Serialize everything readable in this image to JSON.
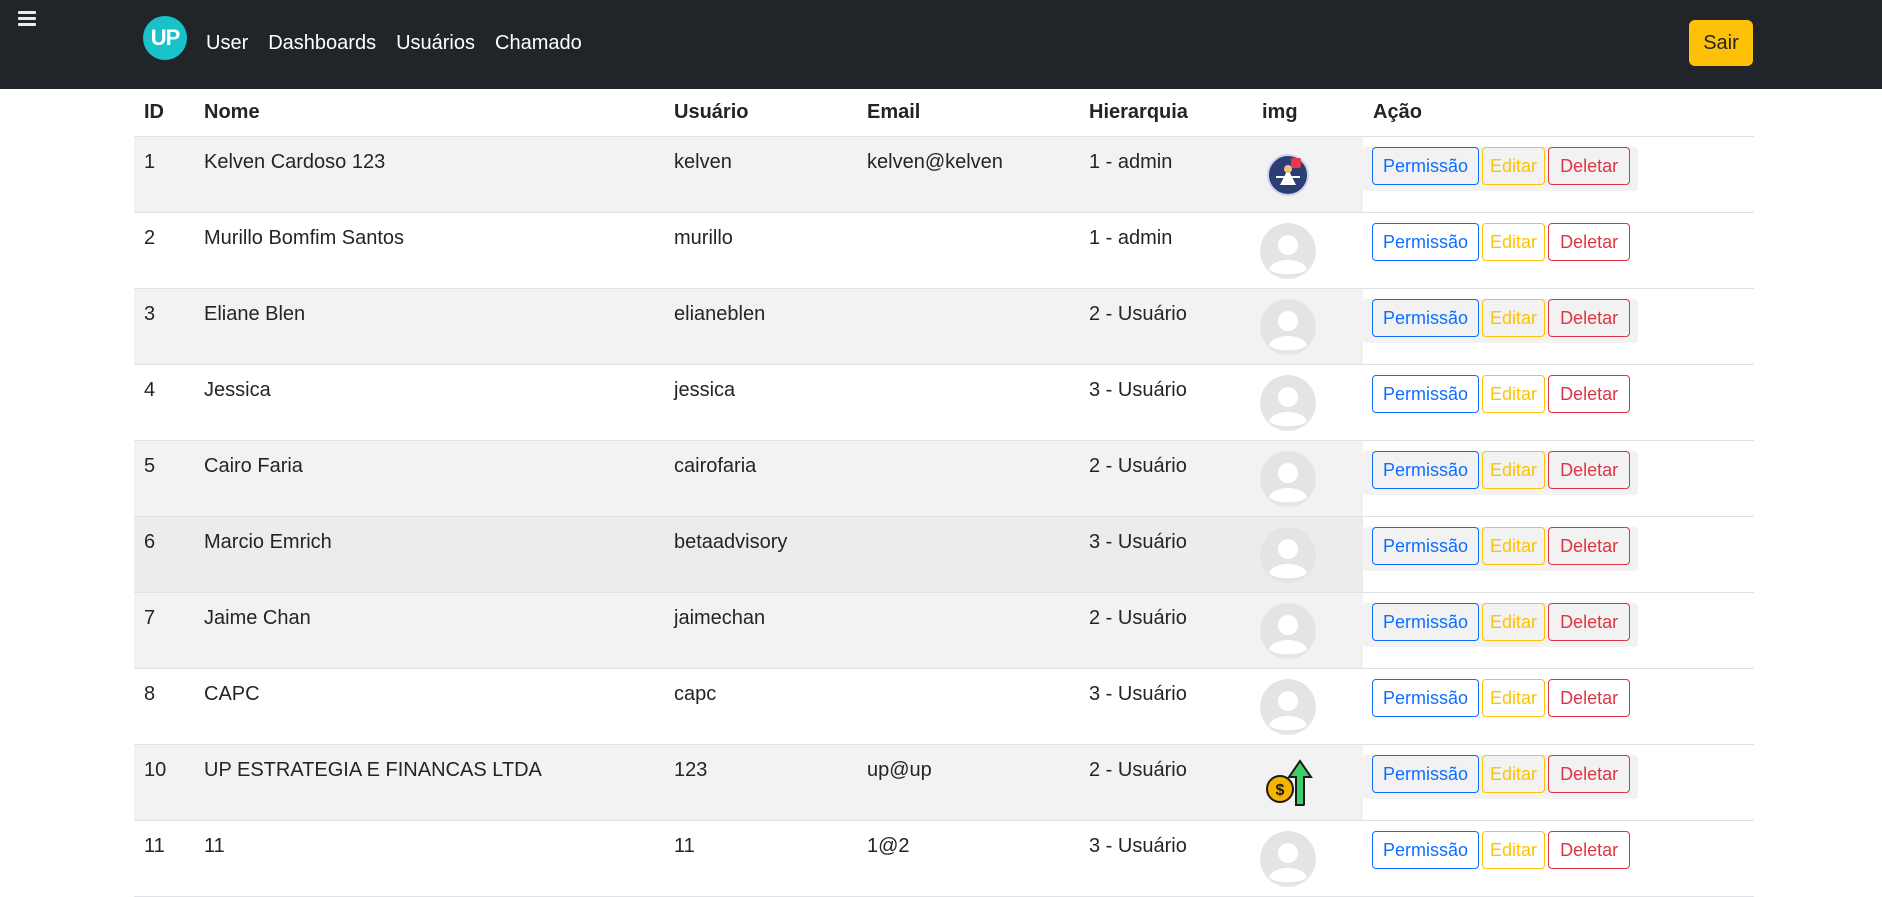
{
  "header": {
    "logo_text": "UP",
    "nav": [
      "User",
      "Dashboards",
      "Usuários",
      "Chamado"
    ],
    "logout_label": "Sair"
  },
  "table": {
    "columns": [
      "ID",
      "Nome",
      "Usuário",
      "Email",
      "Hierarquia",
      "img",
      "Ação"
    ],
    "action_labels": {
      "permission": "Permissão",
      "edit": "Editar",
      "delete": "Deletar"
    },
    "rows": [
      {
        "id": "1",
        "nome": "Kelven Cardoso 123",
        "usuario": "kelven",
        "email": "kelven@kelven",
        "hierarquia": "1 - admin",
        "img": "custom-avatar"
      },
      {
        "id": "2",
        "nome": "Murillo Bomfim Santos",
        "usuario": "murillo",
        "email": "",
        "hierarquia": "1 - admin",
        "img": "default-avatar"
      },
      {
        "id": "3",
        "nome": "Eliane Blen",
        "usuario": "elianeblen",
        "email": "",
        "hierarquia": "2 - Usuário",
        "img": "default-avatar"
      },
      {
        "id": "4",
        "nome": "Jessica",
        "usuario": "jessica",
        "email": "",
        "hierarquia": "3 - Usuário",
        "img": "default-avatar"
      },
      {
        "id": "5",
        "nome": "Cairo Faria",
        "usuario": "cairofaria",
        "email": "",
        "hierarquia": "2 - Usuário",
        "img": "default-avatar"
      },
      {
        "id": "6",
        "nome": "Marcio Emrich",
        "usuario": "betaadvisory",
        "email": "",
        "hierarquia": "3 - Usuário",
        "img": "default-avatar"
      },
      {
        "id": "7",
        "nome": "Jaime Chan",
        "usuario": "jaimechan",
        "email": "",
        "hierarquia": "2 - Usuário",
        "img": "default-avatar"
      },
      {
        "id": "8",
        "nome": "CAPC",
        "usuario": "capc",
        "email": "",
        "hierarquia": "3 - Usuário",
        "img": "default-avatar"
      },
      {
        "id": "10",
        "nome": "UP ESTRATEGIA E FINANCAS LTDA",
        "usuario": "123",
        "email": "up@up",
        "hierarquia": "2 - Usuário",
        "img": "money-arrow-avatar"
      },
      {
        "id": "11",
        "nome": "11",
        "usuario": "11",
        "email": "1@2",
        "hierarquia": "3 - Usuário",
        "img": "default-avatar"
      }
    ]
  },
  "colors": {
    "navbar": "#212529",
    "logo": "#17c3c9",
    "primary": "#0d6efd",
    "warning": "#ffc107",
    "danger": "#dc3545",
    "stripe": "#f2f2f2"
  }
}
